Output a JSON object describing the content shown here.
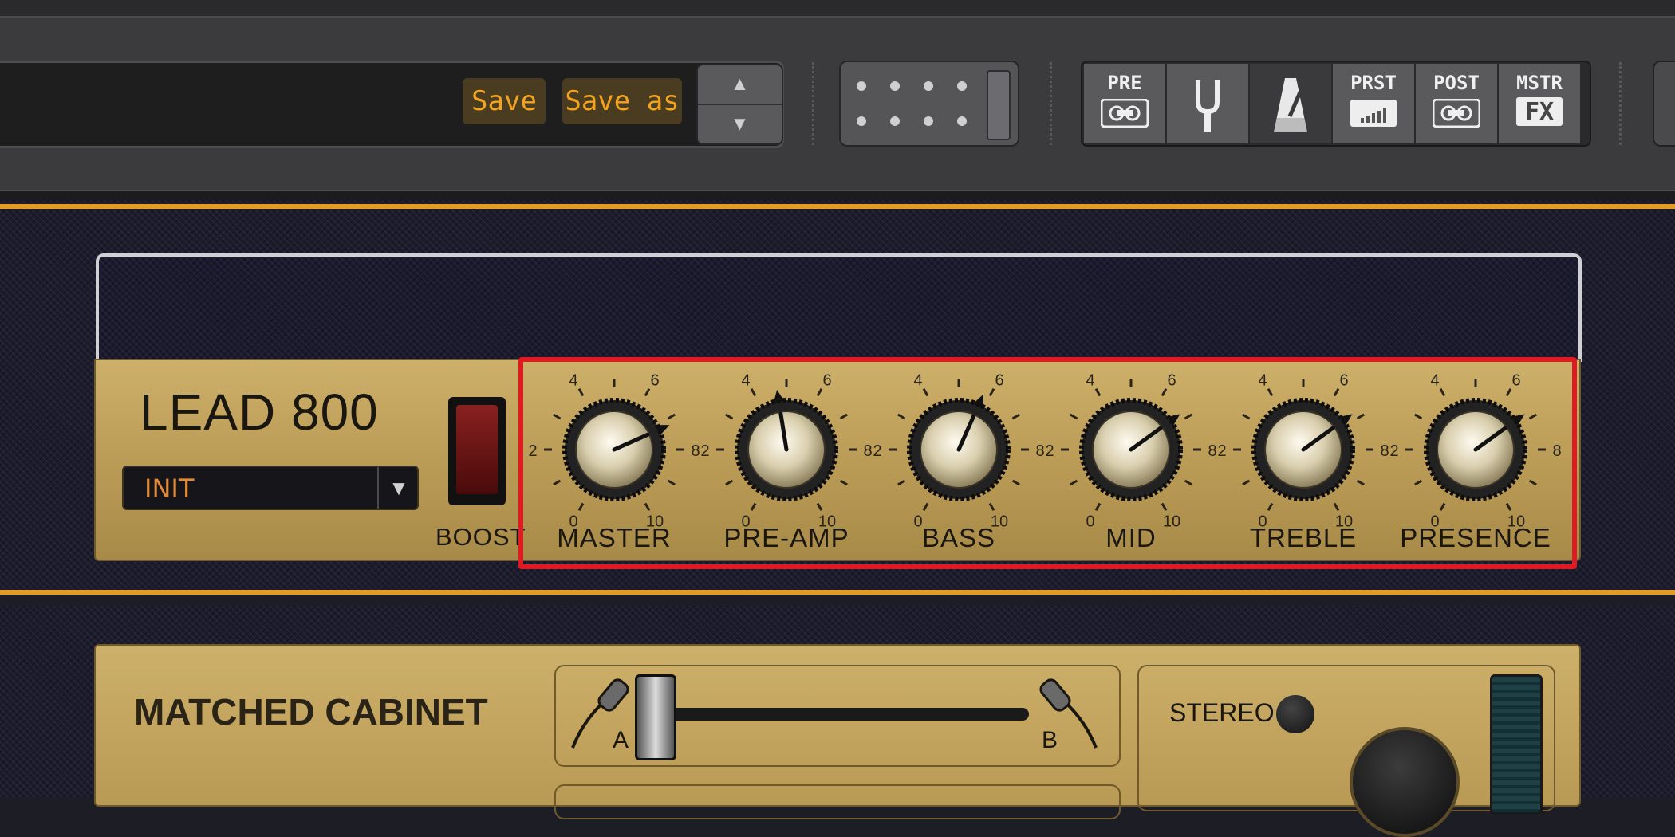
{
  "toolbar": {
    "save_label": "Save",
    "save_as_label": "Save as",
    "stepper": {
      "up_icon": "▲",
      "down_icon": "▼"
    },
    "fx_buttons": [
      {
        "label": "PRE",
        "icon": "tape-icon"
      },
      {
        "label": "",
        "icon": "tuning-fork-icon"
      },
      {
        "label": "",
        "icon": "metronome-icon",
        "active": true
      },
      {
        "label": "PRST",
        "icon": "level-bars-icon"
      },
      {
        "label": "POST",
        "icon": "tape-icon"
      },
      {
        "label": "MSTR",
        "icon": "fx-icon",
        "sublabel": "FX"
      }
    ]
  },
  "amp": {
    "name": "LEAD 800",
    "preset_value": "INIT",
    "dropdown_icon": "▼",
    "boost_label": "BOOST",
    "scale_labels": [
      "0",
      "2",
      "4",
      "6",
      "8",
      "10"
    ],
    "knobs": [
      {
        "label": "MASTER",
        "value": 7.2
      },
      {
        "label": "PRE-AMP",
        "value": 4.7
      },
      {
        "label": "BASS",
        "value": 5.8
      },
      {
        "label": "MID",
        "value": 6.8
      },
      {
        "label": "TREBLE",
        "value": 6.8
      },
      {
        "label": "PRESENCE",
        "value": 6.8
      }
    ],
    "accent_color": "#e39c22",
    "highlight_color": "#e01a22"
  },
  "cabinet": {
    "title": "MATCHED CABINET",
    "mic_a": "A",
    "mic_b": "B",
    "stereo_label": "STEREO"
  }
}
